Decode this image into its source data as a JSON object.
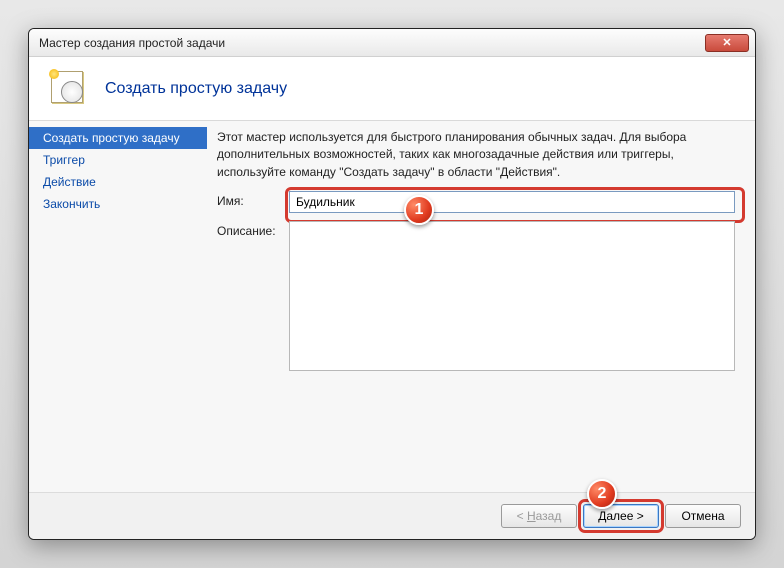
{
  "window": {
    "title": "Мастер создания простой задачи"
  },
  "header": {
    "title": "Создать простую задачу"
  },
  "sidebar": {
    "items": [
      {
        "label": "Создать простую задачу",
        "active": true
      },
      {
        "label": "Триггер",
        "active": false
      },
      {
        "label": "Действие",
        "active": false
      },
      {
        "label": "Закончить",
        "active": false
      }
    ]
  },
  "main": {
    "description": "Этот мастер используется для быстрого планирования обычных задач.  Для выбора дополнительных возможностей, таких как многозадачные действия или триггеры, используйте команду \"Создать задачу\" в области \"Действия\".",
    "name_label": "Имя:",
    "name_value": "Будильник",
    "desc_label": "Описание:",
    "desc_value": ""
  },
  "footer": {
    "back_prefix": "< ",
    "back_u": "Н",
    "back_suffix": "азад",
    "next_u": "Д",
    "next_suffix": "алее >",
    "cancel": "Отмена"
  },
  "callouts": {
    "c1": "1",
    "c2": "2"
  }
}
